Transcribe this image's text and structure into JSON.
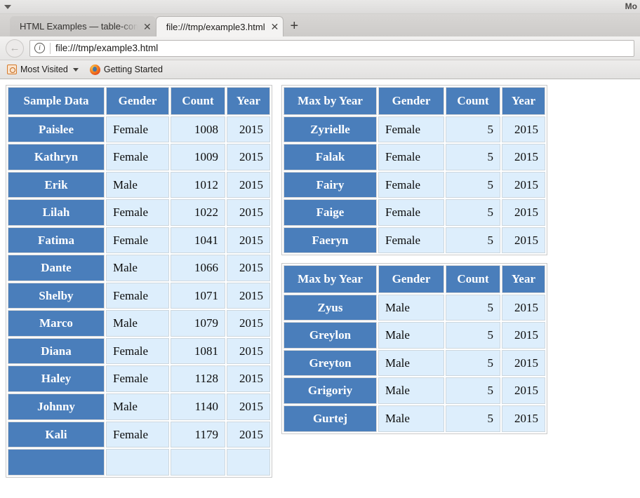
{
  "window": {
    "title": "Mo",
    "tablist_caret": "tab-list-dropdown"
  },
  "tabs": [
    {
      "label": "HTML Examples — table-compo",
      "close": "✕",
      "active": false
    },
    {
      "label": "file:///tmp/example3.html",
      "close": "✕",
      "active": true
    }
  ],
  "newtab_label": "+",
  "nav": {
    "back_glyph": "←",
    "info_glyph": "i",
    "url": "file:///tmp/example3.html"
  },
  "bookmarks": [
    {
      "label": "Most Visited",
      "icon": "most-visited-icon",
      "has_caret": true
    },
    {
      "label": "Getting Started",
      "icon": "firefox-icon",
      "has_caret": false
    }
  ],
  "tables": [
    {
      "id": "sample-data",
      "headers": [
        "Sample Data",
        "Gender",
        "Count",
        "Year"
      ],
      "rows": [
        [
          "Paislee",
          "Female",
          "1008",
          "2015"
        ],
        [
          "Kathryn",
          "Female",
          "1009",
          "2015"
        ],
        [
          "Erik",
          "Male",
          "1012",
          "2015"
        ],
        [
          "Lilah",
          "Female",
          "1022",
          "2015"
        ],
        [
          "Fatima",
          "Female",
          "1041",
          "2015"
        ],
        [
          "Dante",
          "Male",
          "1066",
          "2015"
        ],
        [
          "Shelby",
          "Female",
          "1071",
          "2015"
        ],
        [
          "Marco",
          "Male",
          "1079",
          "2015"
        ],
        [
          "Diana",
          "Female",
          "1081",
          "2015"
        ],
        [
          "Haley",
          "Female",
          "1128",
          "2015"
        ],
        [
          "Johnny",
          "Male",
          "1140",
          "2015"
        ],
        [
          "Kali",
          "Female",
          "1179",
          "2015"
        ],
        [
          "",
          "",
          "",
          ""
        ]
      ]
    },
    {
      "id": "max-by-year-female",
      "headers": [
        "Max by Year",
        "Gender",
        "Count",
        "Year"
      ],
      "rows": [
        [
          "Zyrielle",
          "Female",
          "5",
          "2015"
        ],
        [
          "Falak",
          "Female",
          "5",
          "2015"
        ],
        [
          "Fairy",
          "Female",
          "5",
          "2015"
        ],
        [
          "Faige",
          "Female",
          "5",
          "2015"
        ],
        [
          "Faeryn",
          "Female",
          "5",
          "2015"
        ]
      ]
    },
    {
      "id": "max-by-year-male",
      "headers": [
        "Max by Year",
        "Gender",
        "Count",
        "Year"
      ],
      "rows": [
        [
          "Zyus",
          "Male",
          "5",
          "2015"
        ],
        [
          "Greylon",
          "Male",
          "5",
          "2015"
        ],
        [
          "Greyton",
          "Male",
          "5",
          "2015"
        ],
        [
          "Grigoriy",
          "Male",
          "5",
          "2015"
        ],
        [
          "Gurtej",
          "Male",
          "5",
          "2015"
        ]
      ]
    }
  ],
  "colors": {
    "header_blue": "#4a7ebb",
    "cell_blue": "#ddeefc",
    "header_text": "#ffffff",
    "cell_text": "#0b0b0b"
  }
}
